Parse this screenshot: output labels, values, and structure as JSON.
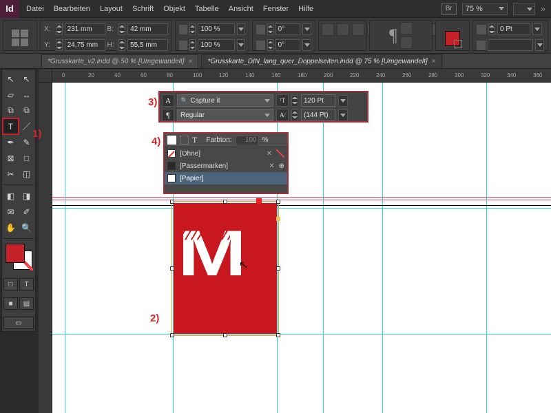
{
  "app": {
    "short": "Id"
  },
  "menu": {
    "items": [
      "Datei",
      "Bearbeiten",
      "Layout",
      "Schrift",
      "Objekt",
      "Tabelle",
      "Ansicht",
      "Fenster",
      "Hilfe"
    ],
    "br": "Br",
    "zoom": "75 %"
  },
  "control": {
    "x": "231 mm",
    "y": "24,75 mm",
    "w": "42 mm",
    "h": "55,5 mm",
    "sx": "100 %",
    "sy": "100 %",
    "rot": "0°",
    "shear": "0°",
    "stroke": "0 Pt"
  },
  "tabs": [
    {
      "label": "*Grusskarte_v2.indd @ 50 % [Umgewandelt]",
      "active": false
    },
    {
      "label": "*Grusskarte_DIN_lang_quer_Doppelseiten.indd @ 75 % [Umgewandelt]",
      "active": true
    }
  ],
  "ruler_h": [
    "0",
    "20",
    "40",
    "60",
    "80",
    "100",
    "120",
    "140",
    "160",
    "180",
    "200",
    "220",
    "240",
    "260",
    "280",
    "300",
    "320",
    "340",
    "360"
  ],
  "annotations": {
    "a1": "1)",
    "a2": "2)",
    "a3": "3)",
    "a4": "4)"
  },
  "charpanel": {
    "font": "Capture it",
    "style": "Regular",
    "size": "120 Pt",
    "leading": "(144 Pt)"
  },
  "swatchpanel": {
    "tint_label": "Farbton:",
    "tint_value": "100",
    "pct": "%",
    "rows": [
      {
        "name": "[Ohne]",
        "kind": "none"
      },
      {
        "name": "[Passermarken]",
        "kind": "dark"
      },
      {
        "name": "[Papier]",
        "kind": "white",
        "selected": true
      }
    ]
  },
  "artwork": {
    "letter": "M"
  }
}
